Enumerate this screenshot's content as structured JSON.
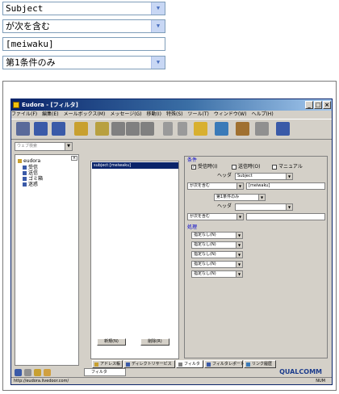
{
  "top_controls": {
    "header_select": {
      "value": "Subject"
    },
    "match_select": {
      "value": "が次を含む"
    },
    "text_input": {
      "value": "[meiwaku]"
    },
    "condition_select": {
      "value": "第1条件のみ"
    }
  },
  "window": {
    "title": "Eudora - [フィルタ]",
    "controls": {
      "minimize": "_",
      "maximize": "□",
      "close": "×"
    },
    "menu": [
      "ファイル(F)",
      "編集(E)",
      "メールボックス(M)",
      "メッセージ(G)",
      "移動(I)",
      "特殊(S)",
      "ツール(T)",
      "ウィンドウ(W)",
      "ヘルプ(H)"
    ],
    "toolbar_icons": [
      "delete-icon",
      "check-mail-icon",
      "send-mail-icon",
      "address-book-icon",
      "new-message-icon",
      "reply-icon",
      "reply-all-icon",
      "forward-icon",
      "prev-icon",
      "next-icon",
      "attach-icon",
      "find-icon",
      "help-icon",
      "print-icon",
      "web-icon"
    ],
    "mailbox_combo": {
      "placeholder": "ウェブ検索"
    },
    "tree": {
      "root": "eudora",
      "items": [
        "受信",
        "送信",
        "ゴミ箱",
        "迷惑"
      ]
    },
    "filter_list": {
      "items": [
        "subject:[meiwaku]"
      ]
    },
    "list_buttons": {
      "new": "新規(N)",
      "remove": "削除(R)"
    },
    "detail": {
      "conditions_label": "条件",
      "checks": [
        {
          "label": "受信時(I)",
          "checked": true
        },
        {
          "label": "送信時(O)",
          "checked": false
        },
        {
          "label": "マニュアル",
          "checked": false
        }
      ],
      "header1_label": "ヘッダ",
      "header1_value": "Subject",
      "match1_value": "が次を含む",
      "text1_value": "[meiwaku]",
      "conjunction_value": "第1条件のみ",
      "header2_label": "ヘッダ",
      "header2_value": "",
      "match2_value": "が次を含む",
      "text2_value": "",
      "actions_label": "処理",
      "actions": [
        "指定なし(N)",
        "指定なし(N)",
        "指定なし(N)",
        "指定なし(N)",
        "指定なし(N)"
      ]
    },
    "tabs": [
      "アドレス帳",
      "ディレクトリサービス",
      "フィルタ",
      "フィルタレポート",
      "リンク履歴"
    ],
    "bottom_tab": "フィルタ",
    "brand": "QUALCOMM",
    "status": {
      "url": "http://eudora.livedoor.com/",
      "indicator": "NUM"
    }
  },
  "colors": {
    "titlebar": "#0a246a",
    "selection": "#0a246a",
    "face": "#d4d0c8",
    "group_label": "#0000cc"
  }
}
